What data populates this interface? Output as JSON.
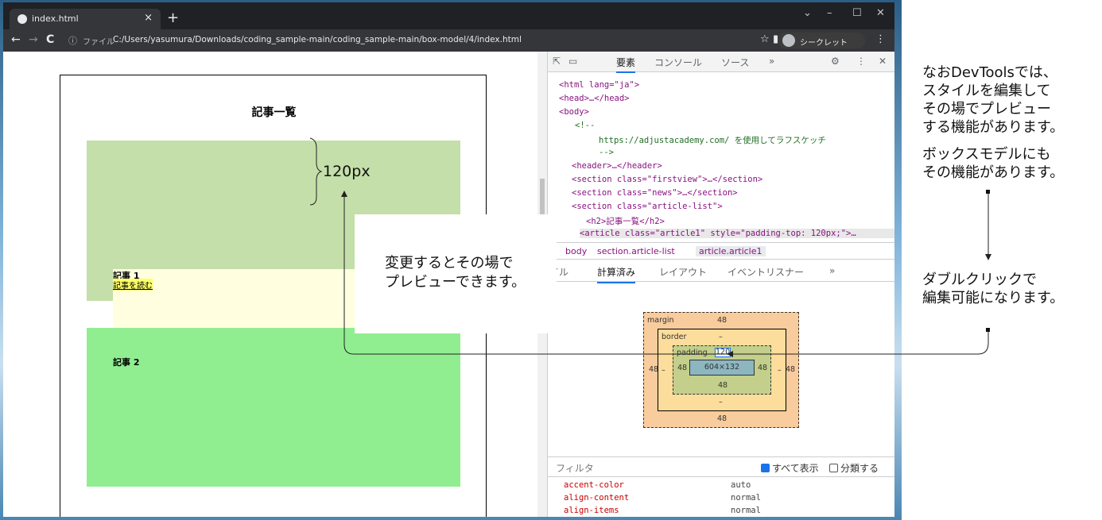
{
  "browser": {
    "tab_title": "index.html",
    "tab_close": "×",
    "new_tab": "+",
    "win_controls": [
      "⌄",
      "–",
      "☐",
      "✕"
    ],
    "nav": [
      "←",
      "→",
      "C"
    ],
    "address_scheme_label": "ファイル",
    "address_url": "C:/Users/yasumura/Downloads/coding_sample-main/coding_sample-main/box-model/4/index.html",
    "incognito_label": "シークレット"
  },
  "page": {
    "title": "記事一覧",
    "article1_label": "記事 1",
    "article1_link": "記事を読む",
    "article2_label": "記事 2"
  },
  "devtools": {
    "tabs": [
      "要素",
      "コンソール",
      "ソース",
      "»"
    ],
    "dom_lines": [
      {
        "html": "&lt;html lang=\"ja\"&gt;"
      },
      {
        "html": "&lt;head&gt;…&lt;/head&gt;"
      },
      {
        "html": "&lt;body&gt;"
      },
      {
        "html": "&lt;!--"
      },
      {
        "html": "https://adjustacademy.com/ を使用してラフスケッチ"
      },
      {
        "html": "--&gt;"
      },
      {
        "html": "&lt;header&gt;…&lt;/header&gt;"
      },
      {
        "html": "&lt;section class=\"firstview\"&gt;…&lt;/section&gt;"
      },
      {
        "html": "&lt;section class=\"news\"&gt;…&lt;/section&gt;"
      },
      {
        "html": "&lt;section class=\"article-list\"&gt;"
      },
      {
        "html": "&lt;h2&gt;記事一覧&lt;/h2&gt;"
      },
      {
        "html": "&lt;article class=\"article1\" style=\"padding-top: 120px;\"&gt;…"
      }
    ],
    "crumbs": [
      "l",
      "body",
      "section.article-list",
      "article.article1"
    ],
    "sub_tabs": [
      "イル",
      "計算済み",
      "レイアウト",
      "イベントリスナー",
      "»"
    ],
    "box_model": {
      "margin_label": "margin",
      "margin_top": "48",
      "margin_left": "48",
      "margin_right": "48",
      "margin_bottom": "48",
      "border_label": "border",
      "border_top": "–",
      "border_left": "–",
      "border_right": "–",
      "border_bottom": "–",
      "padding_label": "padding",
      "padding_top": "120",
      "padding_left": "48",
      "padding_right": "48",
      "padding_bottom": "48",
      "content": "604×132"
    },
    "filter_placeholder": "フィルタ",
    "show_all": "すべて表示",
    "group": "分類する",
    "properties": [
      {
        "name": "accent-color",
        "value": "auto"
      },
      {
        "name": "align-content",
        "value": "normal"
      },
      {
        "name": "align-items",
        "value": "normal"
      }
    ]
  },
  "annotations": {
    "px_label": "120px",
    "callout_line1": "変更するとその場で",
    "callout_line2": "プレビューできます。",
    "note1": [
      "なおDevToolsでは、",
      "スタイルを編集して",
      "その場でプレビュー",
      "する機能があります。"
    ],
    "note2": [
      "ボックスモデルにも",
      "その機能があります。"
    ],
    "note3": [
      "ダブルクリックで",
      "編集可能になります。"
    ]
  },
  "colors": {
    "article1_bg": "#c4dfa9",
    "article1_inner_bg": "#ffffe0",
    "article2_bg": "#90ee90",
    "margin_bg": "#f9cc9d",
    "border_bg": "#fddd9b",
    "padding_bg": "#c3cf8a",
    "content_bg": "#8cb6c0"
  }
}
